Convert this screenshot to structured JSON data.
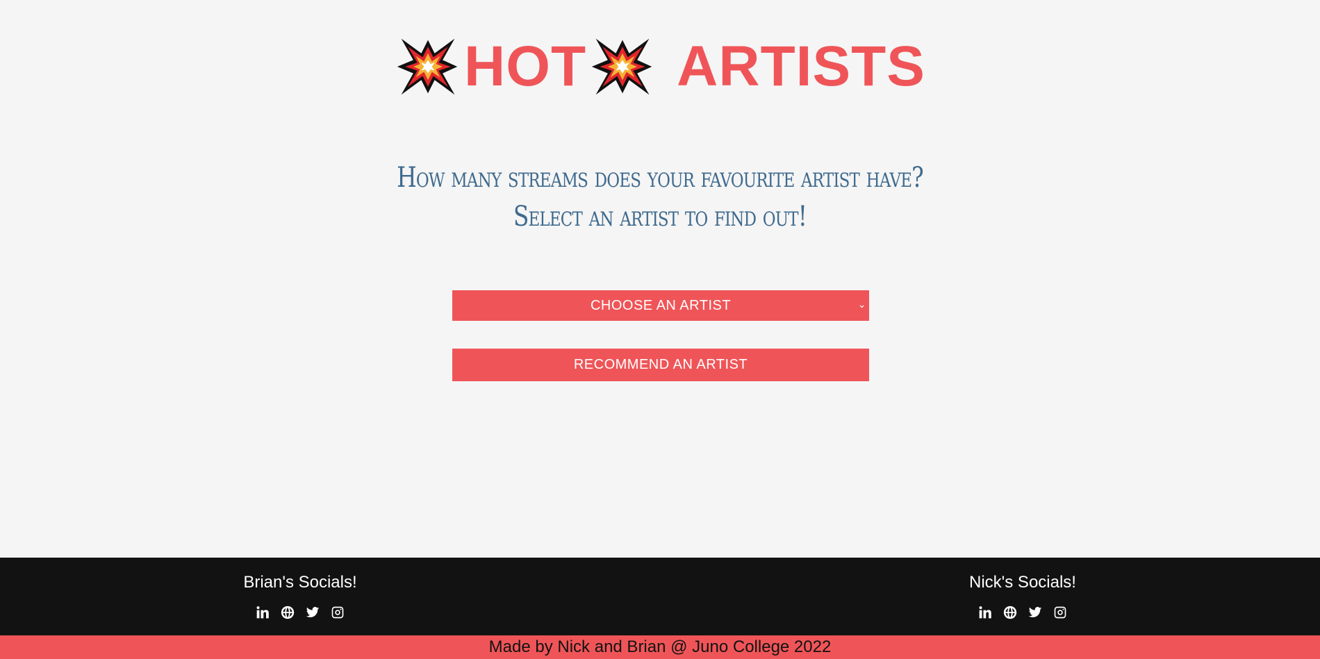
{
  "header": {
    "title_word1": "HOT",
    "title_word2": "ARTISTS",
    "icon": "collision-burst-icon",
    "accent_color": "#ef5558"
  },
  "intro": {
    "line1": "How many streams does your favourite artist have?",
    "line2": "Select an artist to find out!"
  },
  "artist_select": {
    "selected_label": "CHOOSE AN ARTIST"
  },
  "recommend_button": {
    "label": "RECOMMEND AN ARTIST"
  },
  "footer": {
    "brian": {
      "title": "Brian's Socials!",
      "icons": [
        "linkedin-icon",
        "globe-icon",
        "twitter-icon",
        "instagram-icon"
      ]
    },
    "nick": {
      "title": "Nick's Socials!",
      "icons": [
        "linkedin-icon",
        "globe-icon",
        "twitter-icon",
        "instagram-icon"
      ]
    },
    "credit": "Made by Nick and Brian @ Juno College 2022"
  }
}
